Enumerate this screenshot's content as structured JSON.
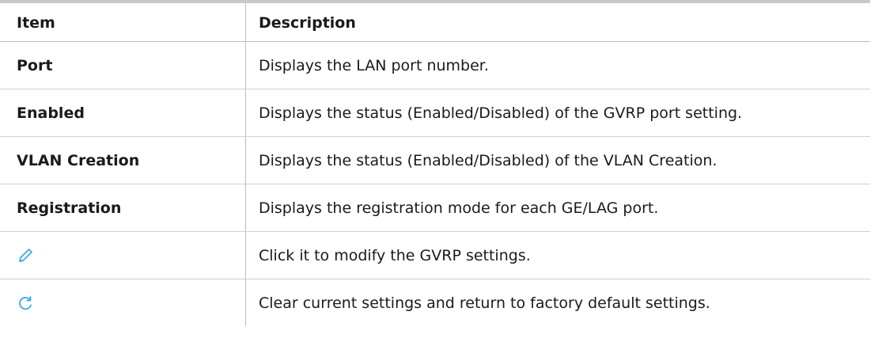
{
  "table": {
    "header": {
      "item": "Item",
      "description": "Description"
    },
    "rows": [
      {
        "item": "Port",
        "description": "Displays the LAN port number."
      },
      {
        "item": "Enabled",
        "description": "Displays the status (Enabled/Disabled) of the GVRP port setting."
      },
      {
        "item": "VLAN Creation",
        "description": "Displays the status (Enabled/Disabled) of the VLAN Creation."
      },
      {
        "item": "Registration",
        "description": "Displays the registration mode for each GE/LAG port."
      },
      {
        "icon": "pencil-edit-icon",
        "description": "Click it to modify the GVRP settings."
      },
      {
        "icon": "refresh-icon",
        "description": "Clear current settings and return to factory default settings."
      }
    ]
  },
  "colors": {
    "icon_blue": "#3aa8e8",
    "border": "#c8c8c8"
  }
}
